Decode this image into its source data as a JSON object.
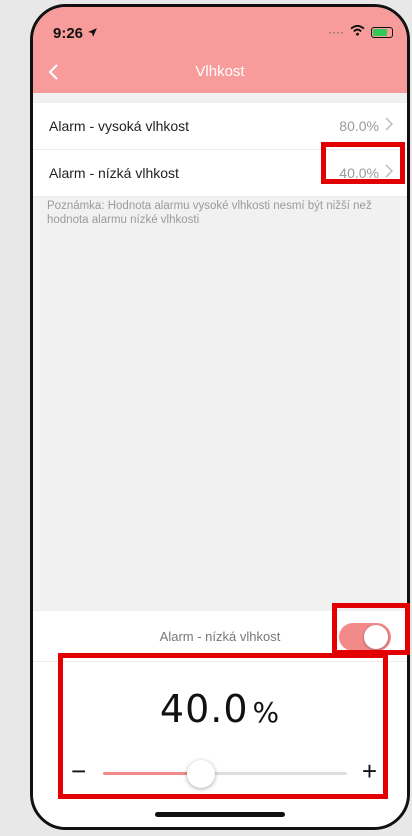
{
  "status": {
    "time": "9:26"
  },
  "header": {
    "title": "Vlhkost"
  },
  "list": [
    {
      "label": "Alarm - vysoká vlhkost",
      "value": "80.0%"
    },
    {
      "label": "Alarm - nízká vlhkost",
      "value": "40.0%"
    }
  ],
  "note": "Poznámka: Hodnota alarmu vysoké vlhkosti nesmí být nižší než hodnota alarmu nízké vlhkosti",
  "bottom": {
    "toggle_label": "Alarm - nízká vlhkost",
    "toggle_on": true,
    "value": "40.0",
    "unit": "%",
    "slider_fraction": 0.4
  },
  "colors": {
    "header": "#f79b9b",
    "accent": "#f38a8a",
    "highlight": "#e20000"
  },
  "icons": [
    "back-chevron-icon",
    "location-arrow-icon",
    "wifi-icon",
    "battery-icon",
    "chevron-right-icon",
    "minus-icon",
    "plus-icon"
  ]
}
